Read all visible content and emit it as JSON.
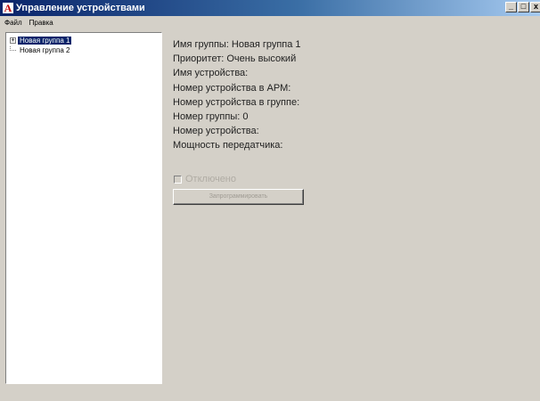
{
  "window": {
    "title": "Управление устройствами",
    "app_icon_glyph": "A",
    "buttons": {
      "minimize": "_",
      "maximize": "□",
      "close": "x"
    }
  },
  "menu": [
    {
      "label": "Файл"
    },
    {
      "label": "Правка"
    }
  ],
  "tree": {
    "items": [
      {
        "label": "Новая группа 1",
        "selected": true,
        "expander": "+"
      },
      {
        "label": "Новая группа 2",
        "selected": false
      }
    ]
  },
  "details": {
    "lines": [
      "Имя группы: Новая группа 1",
      "Приоритет: Очень высокий",
      "Имя устройства:",
      "Номер устройства в АРМ:",
      "Номер устройства в группе:",
      "Номер группы: 0",
      "Номер устройства:",
      "Мощность передатчика:"
    ],
    "disabled_checkbox_label": "Отключено",
    "program_button_label": "Запрограммировать"
  },
  "colors": {
    "titlebar_start": "#0a246a",
    "titlebar_end": "#a6caf0",
    "background": "#d4d0c8",
    "selection": "#0a246a"
  }
}
